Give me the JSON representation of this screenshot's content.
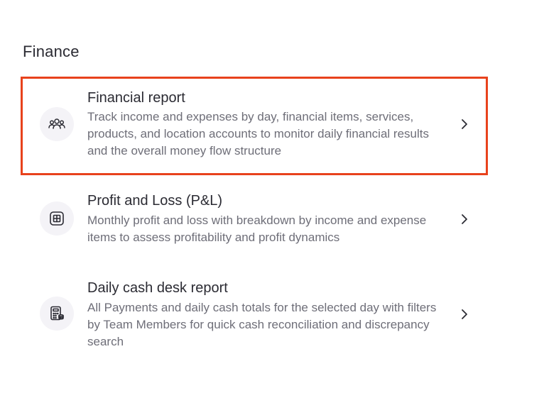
{
  "section": {
    "title": "Finance"
  },
  "items": [
    {
      "title": "Financial report",
      "description": "Track income and expenses by day, financial items, services, products, and location accounts to monitor daily financial results and the overall money flow structure",
      "icon": "people-icon",
      "highlighted": true
    },
    {
      "title": "Profit and Loss (P&L)",
      "description": "Monthly profit and loss with breakdown by income and expense items to assess profitability and profit dynamics",
      "icon": "table-grid-icon",
      "highlighted": false
    },
    {
      "title": "Daily cash desk report",
      "description": "All Payments and daily cash totals for the selected day with filters by Team Members for quick cash reconciliation and discrepancy search",
      "icon": "calculator-icon",
      "highlighted": false
    }
  ],
  "colors": {
    "highlight": "#e8421c",
    "icon_bg": "#f4f3f7",
    "text_primary": "#2b2b33",
    "text_secondary": "#6e6e78"
  }
}
